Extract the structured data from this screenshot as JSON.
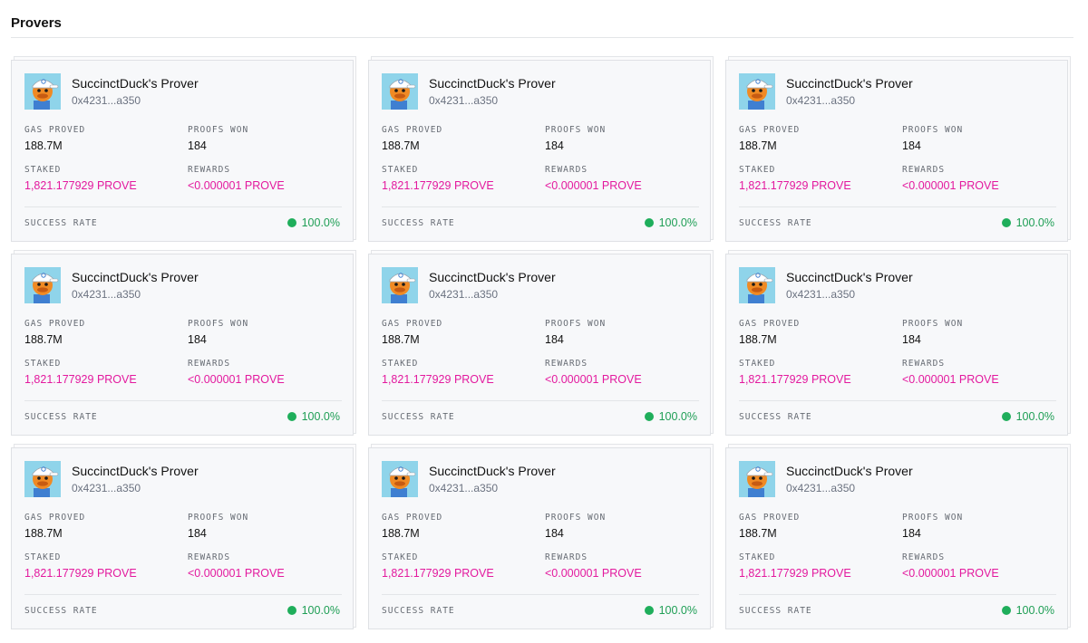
{
  "section": {
    "title": "Provers"
  },
  "colors": {
    "accent_pink": "#e3199e",
    "success_green": "#1fae5b"
  },
  "labels": {
    "gas_proved": "GAS PROVED",
    "proofs_won": "PROOFS WON",
    "staked": "STAKED",
    "rewards": "REWARDS",
    "success_rate": "SUCCESS RATE"
  },
  "provers": [
    {
      "name": "SuccinctDuck's Prover",
      "address": "0x4231...a350",
      "gas_proved": "188.7M",
      "proofs_won": "184",
      "staked": "1,821.177929 PROVE",
      "rewards": "<0.000001 PROVE",
      "success_rate": "100.0%",
      "avatar_icon": "duck-avatar-icon"
    },
    {
      "name": "SuccinctDuck's Prover",
      "address": "0x4231...a350",
      "gas_proved": "188.7M",
      "proofs_won": "184",
      "staked": "1,821.177929 PROVE",
      "rewards": "<0.000001 PROVE",
      "success_rate": "100.0%",
      "avatar_icon": "duck-avatar-icon"
    },
    {
      "name": "SuccinctDuck's Prover",
      "address": "0x4231...a350",
      "gas_proved": "188.7M",
      "proofs_won": "184",
      "staked": "1,821.177929 PROVE",
      "rewards": "<0.000001 PROVE",
      "success_rate": "100.0%",
      "avatar_icon": "duck-avatar-icon"
    },
    {
      "name": "SuccinctDuck's Prover",
      "address": "0x4231...a350",
      "gas_proved": "188.7M",
      "proofs_won": "184",
      "staked": "1,821.177929 PROVE",
      "rewards": "<0.000001 PROVE",
      "success_rate": "100.0%",
      "avatar_icon": "duck-avatar-icon"
    },
    {
      "name": "SuccinctDuck's Prover",
      "address": "0x4231...a350",
      "gas_proved": "188.7M",
      "proofs_won": "184",
      "staked": "1,821.177929 PROVE",
      "rewards": "<0.000001 PROVE",
      "success_rate": "100.0%",
      "avatar_icon": "duck-avatar-icon"
    },
    {
      "name": "SuccinctDuck's Prover",
      "address": "0x4231...a350",
      "gas_proved": "188.7M",
      "proofs_won": "184",
      "staked": "1,821.177929 PROVE",
      "rewards": "<0.000001 PROVE",
      "success_rate": "100.0%",
      "avatar_icon": "duck-avatar-icon"
    },
    {
      "name": "SuccinctDuck's Prover",
      "address": "0x4231...a350",
      "gas_proved": "188.7M",
      "proofs_won": "184",
      "staked": "1,821.177929 PROVE",
      "rewards": "<0.000001 PROVE",
      "success_rate": "100.0%",
      "avatar_icon": "duck-avatar-icon"
    },
    {
      "name": "SuccinctDuck's Prover",
      "address": "0x4231...a350",
      "gas_proved": "188.7M",
      "proofs_won": "184",
      "staked": "1,821.177929 PROVE",
      "rewards": "<0.000001 PROVE",
      "success_rate": "100.0%",
      "avatar_icon": "duck-avatar-icon"
    },
    {
      "name": "SuccinctDuck's Prover",
      "address": "0x4231...a350",
      "gas_proved": "188.7M",
      "proofs_won": "184",
      "staked": "1,821.177929 PROVE",
      "rewards": "<0.000001 PROVE",
      "success_rate": "100.0%",
      "avatar_icon": "duck-avatar-icon"
    }
  ]
}
